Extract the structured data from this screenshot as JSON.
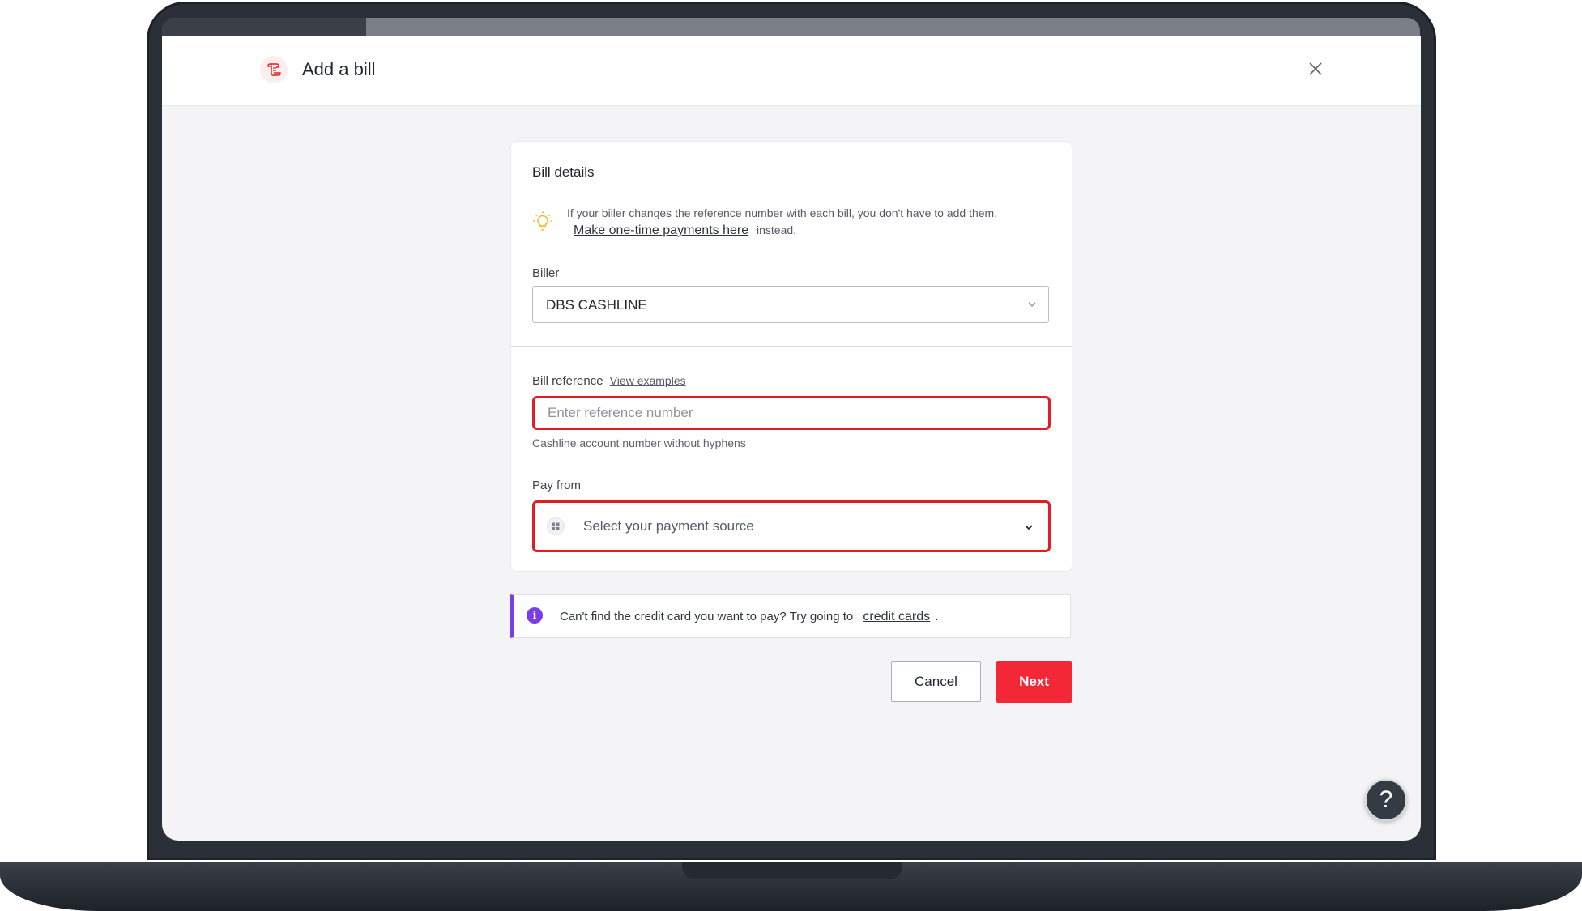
{
  "header": {
    "title": "Add a bill",
    "icon": "bill-receipt-icon",
    "close_icon": "close-icon"
  },
  "bill_details": {
    "title": "Bill details",
    "tip": {
      "icon": "lightbulb-icon",
      "text_before": "If your biller changes the reference number with each bill, you don't have to add them.",
      "link": "Make one-time payments here",
      "text_after": "instead."
    },
    "biller": {
      "label": "Biller",
      "value": "DBS CASHLINE"
    },
    "bill_reference": {
      "label": "Bill reference",
      "link": "View examples",
      "placeholder": "Enter reference number",
      "helper": "Cashline account number without hyphens"
    },
    "pay_from": {
      "label": "Pay from",
      "placeholder": "Select your payment source"
    }
  },
  "info": {
    "text": "Can't find the credit card you want to pay? Try going to",
    "link": "credit cards",
    "suffix": "."
  },
  "actions": {
    "cancel_label": "Cancel",
    "next_label": "Next"
  },
  "help": {
    "label": "?"
  },
  "colors": {
    "accent_red": "#f32735",
    "highlight_red": "#e31b23",
    "info_purple": "#7a3ee8",
    "tip_yellow": "#f2b51a"
  }
}
